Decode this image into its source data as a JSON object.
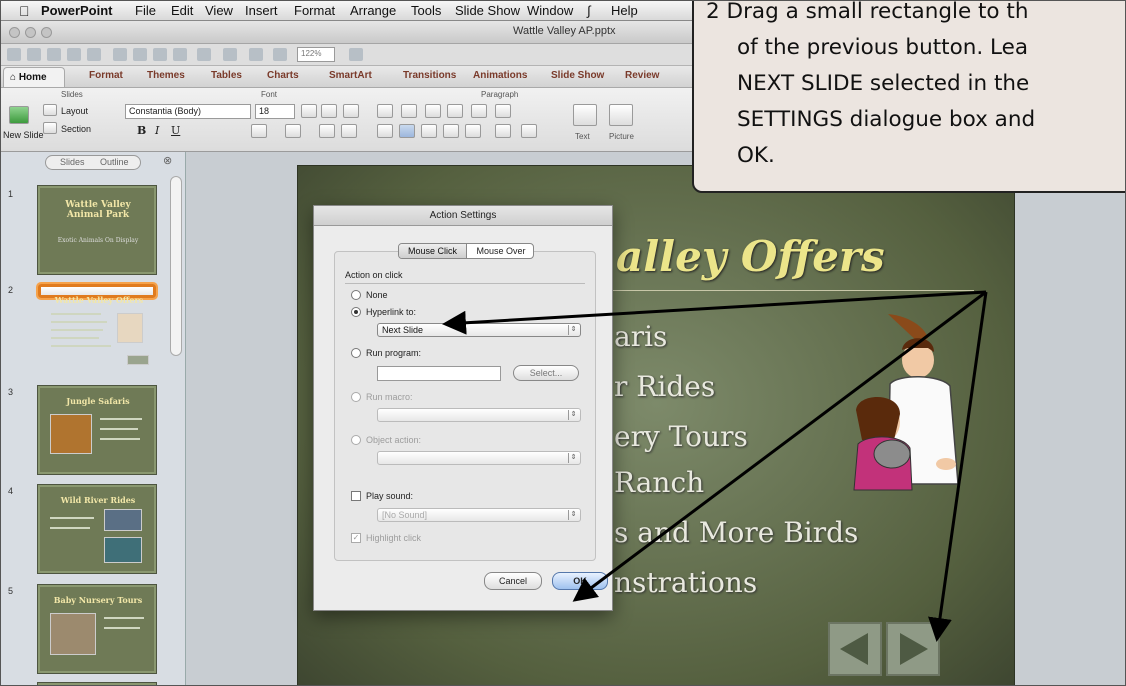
{
  "menubar": {
    "apple_icon": "apple-icon",
    "items": [
      "PowerPoint",
      "File",
      "Edit",
      "View",
      "Insert",
      "Format",
      "Arrange",
      "Tools",
      "Slide Show",
      "Window",
      "Help"
    ]
  },
  "window": {
    "title": "Wattle Valley AP.pptx",
    "zoom": "122%"
  },
  "ribbon": {
    "tabs": [
      "Home",
      "Format",
      "Themes",
      "Tables",
      "Charts",
      "SmartArt",
      "Transitions",
      "Animations",
      "Slide Show",
      "Review"
    ],
    "groups": {
      "slides": "Slides",
      "font": "Font",
      "paragraph": "Paragraph"
    },
    "new_slide": "New Slide",
    "layout": "Layout",
    "section": "Section",
    "font_name": "Constantia (Body)",
    "font_size": "18",
    "text_label": "Text",
    "picture_label": "Picture"
  },
  "slides_pane": {
    "tab_slides": "Slides",
    "tab_outline": "Outline",
    "thumbnails": [
      {
        "num": "1",
        "title": "Wattle Valley Animal Park",
        "subtitle": "Exotic Animals On Display"
      },
      {
        "num": "2",
        "title": "Wattle Valley Offers"
      },
      {
        "num": "3",
        "title": "Jungle Safaris"
      },
      {
        "num": "4",
        "title": "Wild River Rides"
      },
      {
        "num": "5",
        "title": "Baby Nursery Tours"
      }
    ]
  },
  "slide": {
    "title": "alley Offers",
    "bullets": [
      "aris",
      "r Rides",
      "ery Tours",
      "Ranch",
      "s and More Birds",
      "nstrations"
    ]
  },
  "dialog": {
    "title": "Action Settings",
    "tab_click": "Mouse Click",
    "tab_over": "Mouse Over",
    "section_label": "Action on click",
    "none": "None",
    "hyperlink": "Hyperlink to:",
    "hyperlink_value": "Next Slide",
    "run_program": "Run program:",
    "select_btn": "Select...",
    "run_macro": "Run macro:",
    "object_action": "Object action:",
    "play_sound": "Play sound:",
    "sound_value": "[No Sound]",
    "highlight": "Highlight click",
    "cancel": "Cancel",
    "ok": "OK"
  },
  "callout": {
    "lines": [
      "2  Drag a small rectangle to th",
      "of the previous button.  Lea",
      "NEXT SLIDE selected in the",
      "SETTINGS dialogue box and",
      "OK."
    ]
  },
  "colors": {
    "accent_selected": "#e07b1e",
    "slide_title": "#ece58a",
    "callout_bg": "#ece5e0"
  }
}
